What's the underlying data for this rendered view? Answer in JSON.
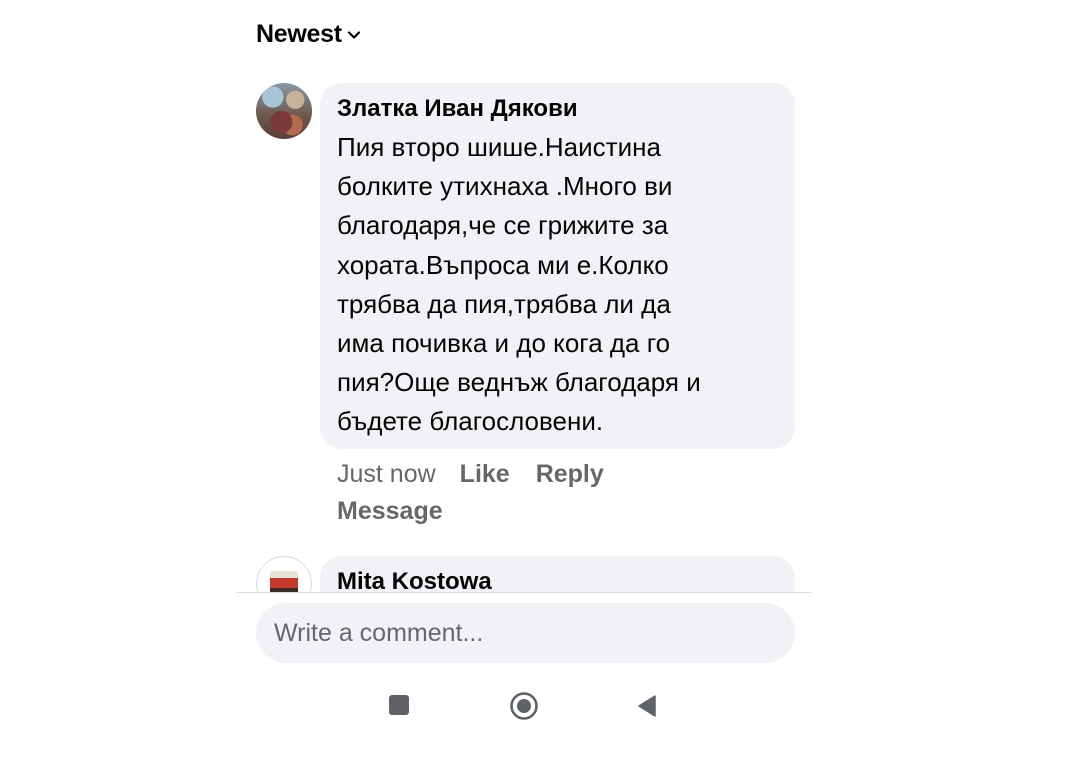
{
  "sort": {
    "label": "Newest",
    "icon": "chevron-down-icon"
  },
  "comments": [
    {
      "author": "Златка Иван Дякови",
      "text_lines": [
        "Пия второ шише.Наистина",
        "болките утихнаха .Много ви",
        "благодаря,че се грижите за",
        "хората.Въпроса ми е.Колко",
        "трябва да пия,трябва ли да",
        "има почивка и до кога да го",
        "пия?Още веднъж благодаря и",
        "бъдете благословени."
      ],
      "time": "Just now",
      "actions": {
        "like": "Like",
        "reply": "Reply",
        "message": "Message"
      }
    },
    {
      "author": "Mita Kostowa"
    }
  ],
  "composer": {
    "placeholder": "Write a comment..."
  },
  "nav": {
    "recents_icon": "square-icon",
    "home_icon": "circle-home-icon",
    "back_icon": "triangle-back-icon"
  },
  "colors": {
    "bubble": "#f0f2f5",
    "text": "#050505",
    "secondary_text": "#65676b",
    "nav_icon": "#5f6368"
  }
}
